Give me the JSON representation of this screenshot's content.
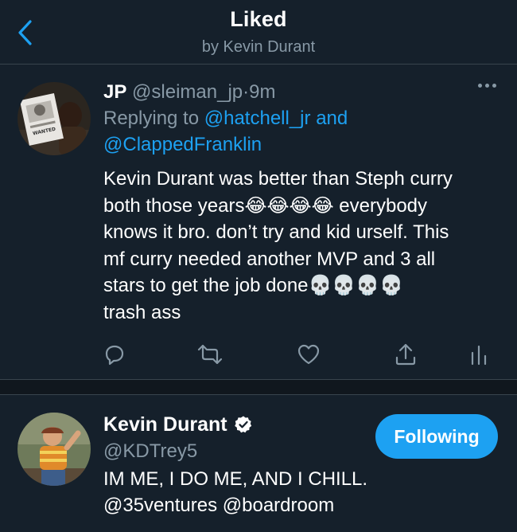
{
  "header": {
    "title": "Liked",
    "subtitle": "by Kevin Durant",
    "back_icon": "chevron-left-icon",
    "accent": "#1da1f2"
  },
  "tweet": {
    "avatar_caption": "WANTED",
    "name": "JP",
    "handle": "@sleiman_jp",
    "dot": "·",
    "time": "9m",
    "replying_prefix": "Replying to",
    "reply_to_1": "@hatchell_jr",
    "reply_and": "and",
    "reply_to_2": "@ClappedFranklin",
    "text_1": "Kevin Durant was better than Steph curry",
    "text_2": "both those years",
    "text_2_emoji": "😂😂😂😂",
    "text_2b": "everybody",
    "text_3": "knows it bro. don’t try and kid urself. This",
    "text_4": "mf curry needed another MVP and 3 all",
    "text_5": "stars to get the job done",
    "text_5_emoji": "💀💀💀💀",
    "text_6": "trash ass",
    "actions": [
      "reply-icon",
      "retweet-icon",
      "like-icon",
      "share-icon",
      "analytics-icon"
    ]
  },
  "user": {
    "name": "Kevin Durant",
    "verified_icon": "verified-badge-icon",
    "handle": "@KDTrey5",
    "bio_1": "IM ME, I DO ME, AND I CHILL.",
    "bio_2": "@35ventures @boardroom",
    "follow_label": "Following"
  },
  "colors": {
    "background": "#15202b",
    "muted": "#8899a6",
    "divider": "#38444d"
  }
}
